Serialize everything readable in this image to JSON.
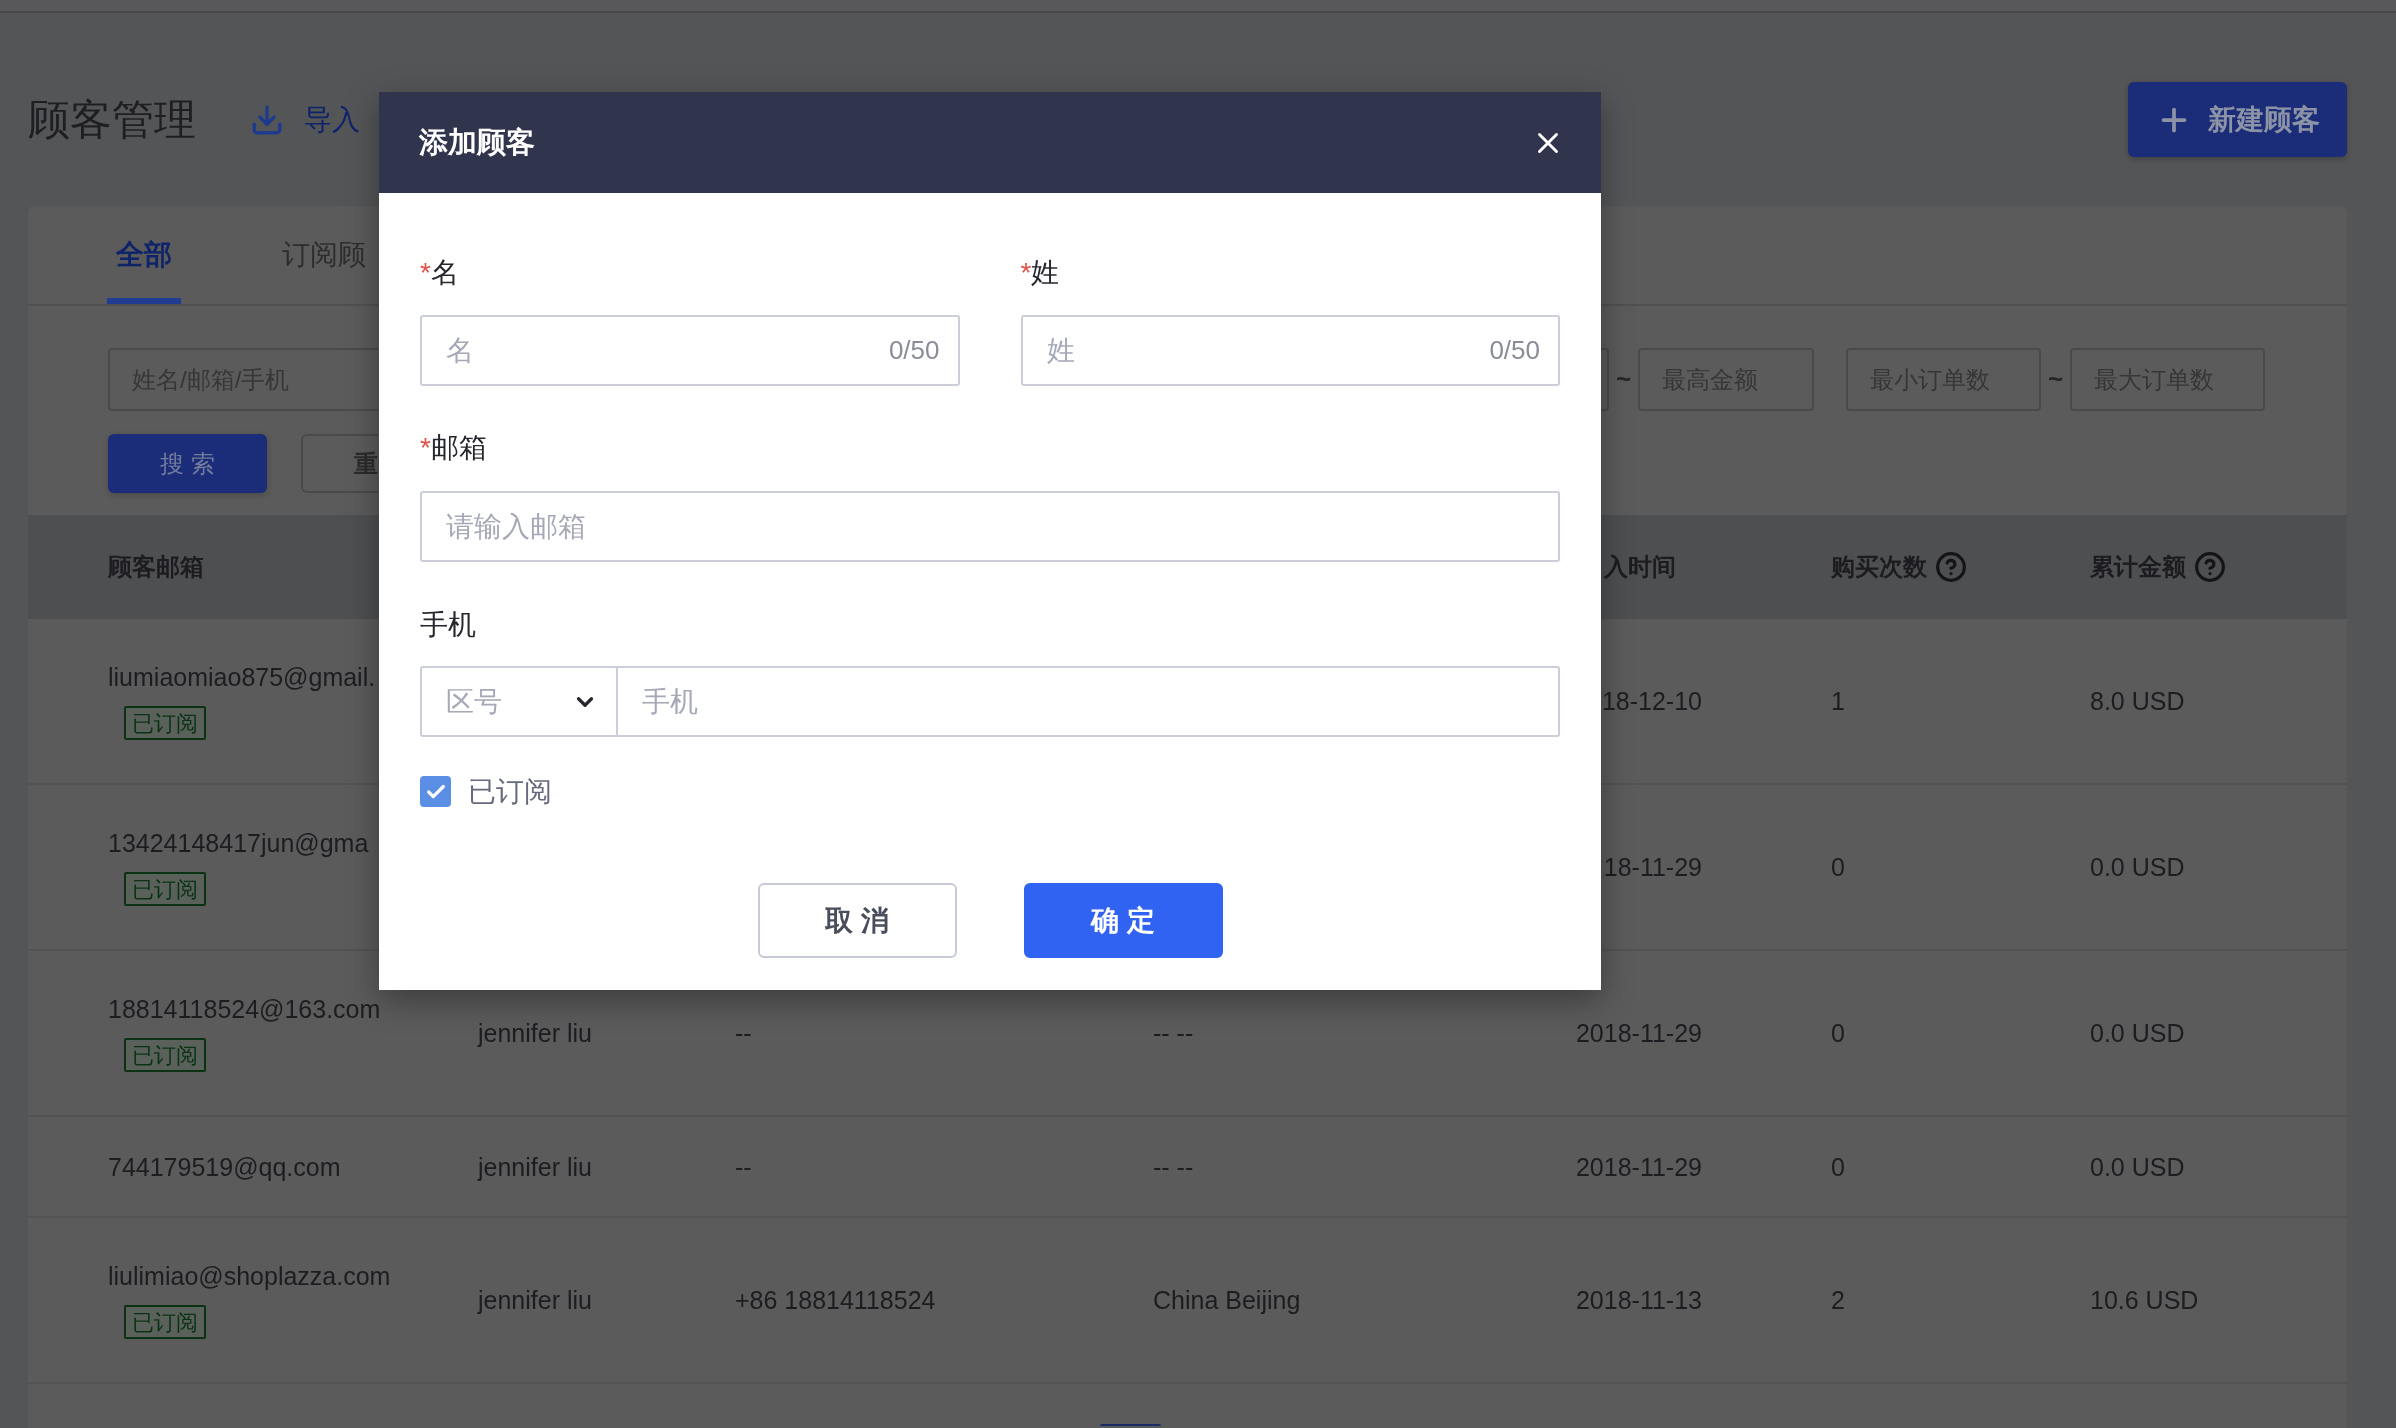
{
  "header": {
    "title": "顾客管理",
    "import_label": "导入",
    "new_button": "新建顾客"
  },
  "tabs": [
    {
      "label": "全部",
      "selected": true
    },
    {
      "label": "订阅顾",
      "selected": false
    }
  ],
  "filters": {
    "query_placeholder": "姓名/邮箱/手机",
    "amount_separator": "~",
    "max_amount_placeholder": "最高金额",
    "min_orders_placeholder": "最小订单数",
    "orders_separator": "~",
    "max_orders_placeholder": "最大订单数",
    "search_button": "搜 索",
    "reset_button": "重"
  },
  "table": {
    "columns": [
      {
        "kind": "email",
        "label": "顾客邮箱",
        "help": false
      },
      {
        "kind": "date",
        "label": "入时间",
        "help": false
      },
      {
        "kind": "purchases",
        "label": "购买次数",
        "help": true
      },
      {
        "kind": "total",
        "label": "累计金额",
        "help": true
      }
    ],
    "rows": [
      {
        "email": "liumiaomiao875@gmail.",
        "tag": "已订阅",
        "date": "18-12-10",
        "purchases": "1",
        "total": "8.0 USD"
      },
      {
        "email": "13424148417jun@gma",
        "tag": "已订阅",
        "date": "18-11-29",
        "purchases": "0",
        "total": "0.0 USD"
      },
      {
        "email": "18814118524@163.com",
        "tag": "已订阅",
        "column_2": "jennifer liu",
        "column_3": "--",
        "column_4": "-- --",
        "date": "2018-11-29",
        "purchases": "0",
        "total": "0.0 USD"
      },
      {
        "email": "744179519@qq.com",
        "column_2": "jennifer liu",
        "column_3": "--",
        "column_4": "-- --",
        "date": "2018-11-29",
        "purchases": "0",
        "total": "0.0 USD"
      },
      {
        "email": "liulimiao@shoplazza.com",
        "tag": "已订阅",
        "column_2": "jennifer liu",
        "column_3": "+86 18814118524",
        "column_4": "China Beijing",
        "date": "2018-11-13",
        "purchases": "2",
        "total": "10.6 USD"
      }
    ]
  },
  "pagination": [
    {
      "selected": true
    }
  ],
  "dialog": {
    "title": "添加顾客",
    "name_fields": [
      {
        "mark": "*",
        "label": "名",
        "placeholder": "名",
        "counter": "0/50"
      },
      {
        "mark": "*",
        "label": "姓",
        "placeholder": "姓",
        "counter": "0/50"
      }
    ],
    "email": {
      "mark": "*",
      "label": "邮箱",
      "placeholder": "请输入邮箱"
    },
    "phone": {
      "label": "手机",
      "code_placeholder": "区号",
      "placeholder": "手机"
    },
    "subscribed": {
      "label": "已订阅",
      "checked": true
    },
    "buttons": [
      {
        "kind": "secondary",
        "label": "取 消"
      },
      {
        "kind": "primary",
        "label": "确 定"
      }
    ]
  }
}
